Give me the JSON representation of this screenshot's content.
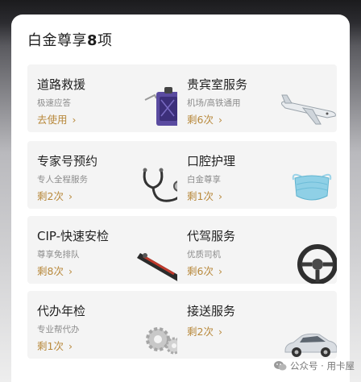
{
  "header": {
    "title_prefix": "白金尊享",
    "title_count": "8",
    "title_suffix": "项"
  },
  "services": [
    {
      "name": "道路救援",
      "sub": "极速应答",
      "action": "去使用"
    },
    {
      "name": "贵宾室服务",
      "sub": "机场/高铁通用",
      "action": "剩6次"
    },
    {
      "name": "专家号预约",
      "sub": "专人全程服务",
      "action": "剩2次"
    },
    {
      "name": "口腔护理",
      "sub": "白金尊享",
      "action": "剩1次"
    },
    {
      "name": "CIP-快速安检",
      "sub": "尊享免排队",
      "action": "剩8次"
    },
    {
      "name": "代驾服务",
      "sub": "优质司机",
      "action": "剩6次"
    },
    {
      "name": "代办年检",
      "sub": "专业帮代办",
      "action": "剩1次"
    },
    {
      "name": "接送服务",
      "sub": "",
      "action": "剩2次"
    }
  ],
  "chevron": "›",
  "watermark": {
    "text": "公众号 · 用卡屋",
    "icon": "wechat-icon"
  },
  "colors": {
    "accent": "#b8893c",
    "tile_bg": "#f4f4f4",
    "title": "#1e1e1e",
    "subtitle": "#8c8c8c"
  }
}
